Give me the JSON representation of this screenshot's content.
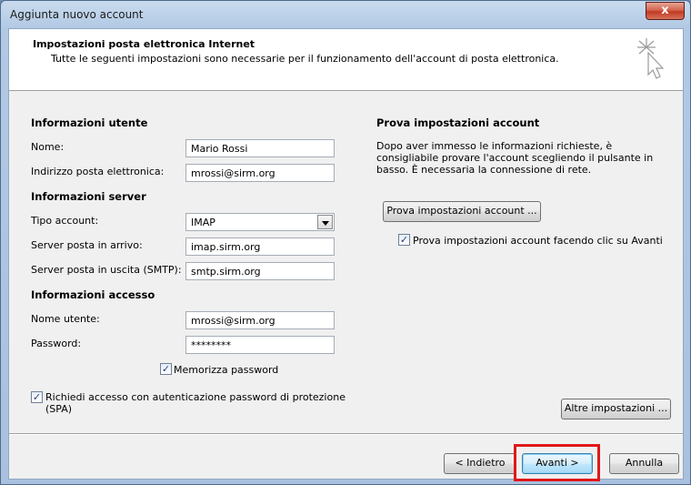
{
  "window": {
    "title": "Aggiunta nuovo account",
    "close_label": "x"
  },
  "header": {
    "title": "Impostazioni posta elettronica Internet",
    "subtitle": "Tutte le seguenti impostazioni sono necessarie per il funzionamento dell'account di posta elettronica."
  },
  "user_info": {
    "section": "Informazioni utente",
    "name_label": "Nome:",
    "name_value": "Mario Rossi",
    "email_label": "Indirizzo posta elettronica:",
    "email_value": "mrossi@sirm.org"
  },
  "server_info": {
    "section": "Informazioni server",
    "account_type_label": "Tipo account:",
    "account_type_value": "IMAP",
    "incoming_label": "Server posta in arrivo:",
    "incoming_value": "imap.sirm.org",
    "outgoing_label": "Server posta in uscita (SMTP):",
    "outgoing_value": "smtp.sirm.org"
  },
  "access_info": {
    "section": "Informazioni accesso",
    "username_label": "Nome utente:",
    "username_value": "mrossi@sirm.org",
    "password_label": "Password:",
    "password_value": "********",
    "remember_label": "Memorizza password",
    "remember_checked": true,
    "spa_label_line1": "Richiedi accesso con autenticazione password di protezione",
    "spa_label_line2": "(SPA)",
    "spa_checked": true
  },
  "test_settings": {
    "section": "Prova impostazioni account",
    "description": "Dopo aver immesso le informazioni richieste, è consigliabile provare l'account scegliendo il pulsante in basso. È necessaria la connessione di rete.",
    "test_button": "Prova impostazioni account ...",
    "auto_test_label": "Prova impostazioni account facendo clic su Avanti",
    "auto_test_checked": true,
    "more_settings_button": "Altre impostazioni ..."
  },
  "footer": {
    "back_button": "< Indietro",
    "next_button": "Avanti >",
    "cancel_button": "Annulla"
  },
  "colors": {
    "highlight": "#e01818",
    "title_bar": "#b2c9e4"
  }
}
